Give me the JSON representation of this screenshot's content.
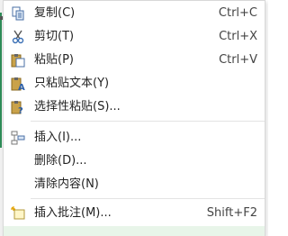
{
  "menu": {
    "items": [
      {
        "label": "复制(C)",
        "shortcut": "Ctrl+C",
        "icon": "copy-icon"
      },
      {
        "label": "剪切(T)",
        "shortcut": "Ctrl+X",
        "icon": "scissors-icon"
      },
      {
        "label": "粘贴(P)",
        "shortcut": "Ctrl+V",
        "icon": "paste-icon"
      },
      {
        "label": "只粘贴文本(Y)",
        "shortcut": "",
        "icon": "paste-text-icon"
      },
      {
        "label": "选择性粘贴(S)...",
        "shortcut": "",
        "icon": "paste-special-icon"
      },
      {
        "label": "插入(I)...",
        "shortcut": "",
        "icon": "insert-icon"
      },
      {
        "label": "删除(D)...",
        "shortcut": "",
        "icon": ""
      },
      {
        "label": "清除内容(N)",
        "shortcut": "",
        "icon": ""
      },
      {
        "label": "插入批注(M)...",
        "shortcut": "Shift+F2",
        "icon": "comment-icon"
      }
    ]
  }
}
